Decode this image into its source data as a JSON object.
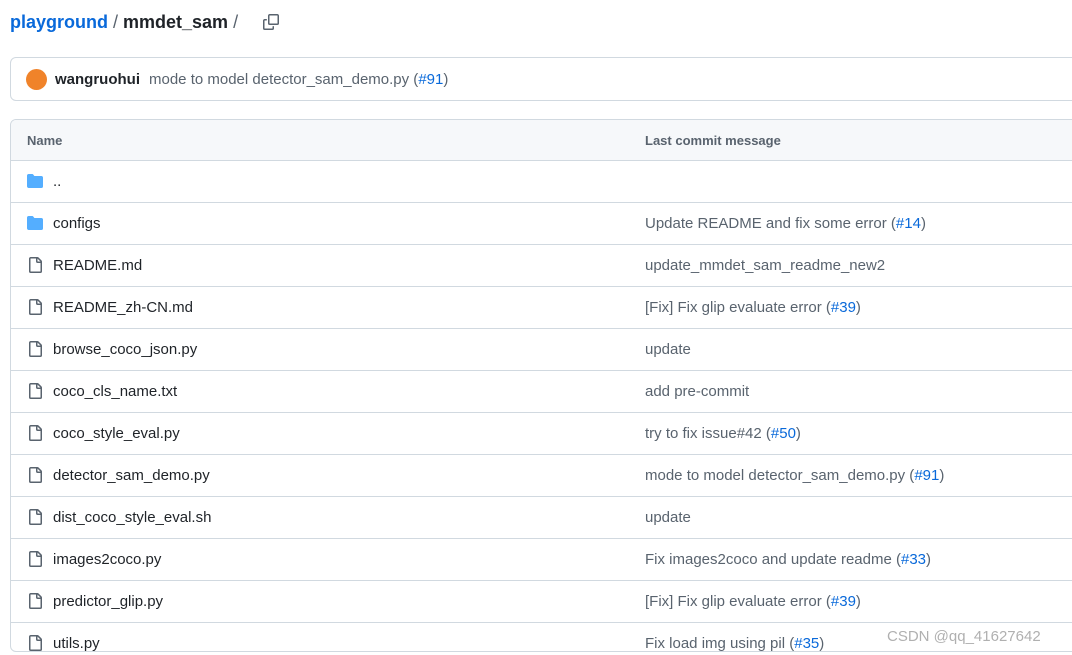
{
  "breadcrumb": {
    "repo": "playground",
    "sep1": "/",
    "folder": "mmdet_sam",
    "sep2": "/"
  },
  "latest_commit": {
    "author": "wangruohui",
    "message": "mode to model detector_sam_demo.py (",
    "pr": "#91",
    "suffix": ")"
  },
  "table": {
    "col_name": "Name",
    "col_message": "Last commit message",
    "rows": [
      {
        "name": "..",
        "type": "folder",
        "msg": "",
        "pr": "",
        "suffix": ""
      },
      {
        "name": "configs",
        "type": "folder",
        "msg": "Update README and fix some error (",
        "pr": "#14",
        "suffix": ")"
      },
      {
        "name": "README.md",
        "type": "file",
        "msg": "update_mmdet_sam_readme_new2",
        "pr": "",
        "suffix": ""
      },
      {
        "name": "README_zh-CN.md",
        "type": "file",
        "msg": "[Fix] Fix glip evaluate error (",
        "pr": "#39",
        "suffix": ")"
      },
      {
        "name": "browse_coco_json.py",
        "type": "file",
        "msg": "update",
        "pr": "",
        "suffix": ""
      },
      {
        "name": "coco_cls_name.txt",
        "type": "file",
        "msg": "add pre-commit",
        "pr": "",
        "suffix": ""
      },
      {
        "name": "coco_style_eval.py",
        "type": "file",
        "msg": "try to fix issue#42 (",
        "pr": "#50",
        "suffix": ")"
      },
      {
        "name": "detector_sam_demo.py",
        "type": "file",
        "msg": "mode to model detector_sam_demo.py (",
        "pr": "#91",
        "suffix": ")"
      },
      {
        "name": "dist_coco_style_eval.sh",
        "type": "file",
        "msg": "update",
        "pr": "",
        "suffix": ""
      },
      {
        "name": "images2coco.py",
        "type": "file",
        "msg": "Fix images2coco and update readme (",
        "pr": "#33",
        "suffix": ")"
      },
      {
        "name": "predictor_glip.py",
        "type": "file",
        "msg": "[Fix] Fix glip evaluate error (",
        "pr": "#39",
        "suffix": ")"
      },
      {
        "name": "utils.py",
        "type": "file",
        "msg": "Fix load img using pil (",
        "pr": "#35",
        "suffix": ")"
      }
    ]
  },
  "watermark": "CSDN @qq_41627642",
  "colors": {
    "link": "#0969da",
    "folder_icon": "#54aeff",
    "file_icon": "#59636e",
    "avatar": "#f0832a"
  }
}
